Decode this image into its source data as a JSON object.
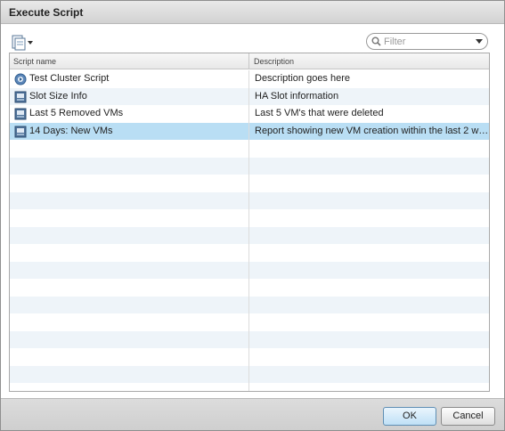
{
  "dialog": {
    "title": "Execute Script"
  },
  "toolbar": {
    "new_script_icon": "script-add-icon"
  },
  "filter": {
    "placeholder": "Filter",
    "value": ""
  },
  "grid": {
    "columns": [
      "Script name",
      "Description"
    ],
    "rows": [
      {
        "name": "Test Cluster Script",
        "description": "Description goes here",
        "icon": "script-gear-icon",
        "selected": false
      },
      {
        "name": "Slot Size Info",
        "description": "HA Slot information",
        "icon": "script-icon",
        "selected": false
      },
      {
        "name": "Last 5 Removed VMs",
        "description": "Last 5 VM's that were deleted",
        "icon": "script-icon",
        "selected": false
      },
      {
        "name": "14 Days: New VMs",
        "description": "Report showing new VM creation within the last 2 wee...",
        "icon": "script-icon",
        "selected": true
      }
    ],
    "empty_row_count": 15
  },
  "buttons": {
    "ok": "OK",
    "cancel": "Cancel"
  },
  "colors": {
    "selected_row": "#b9def4",
    "alt_row": "#eef4f9"
  }
}
